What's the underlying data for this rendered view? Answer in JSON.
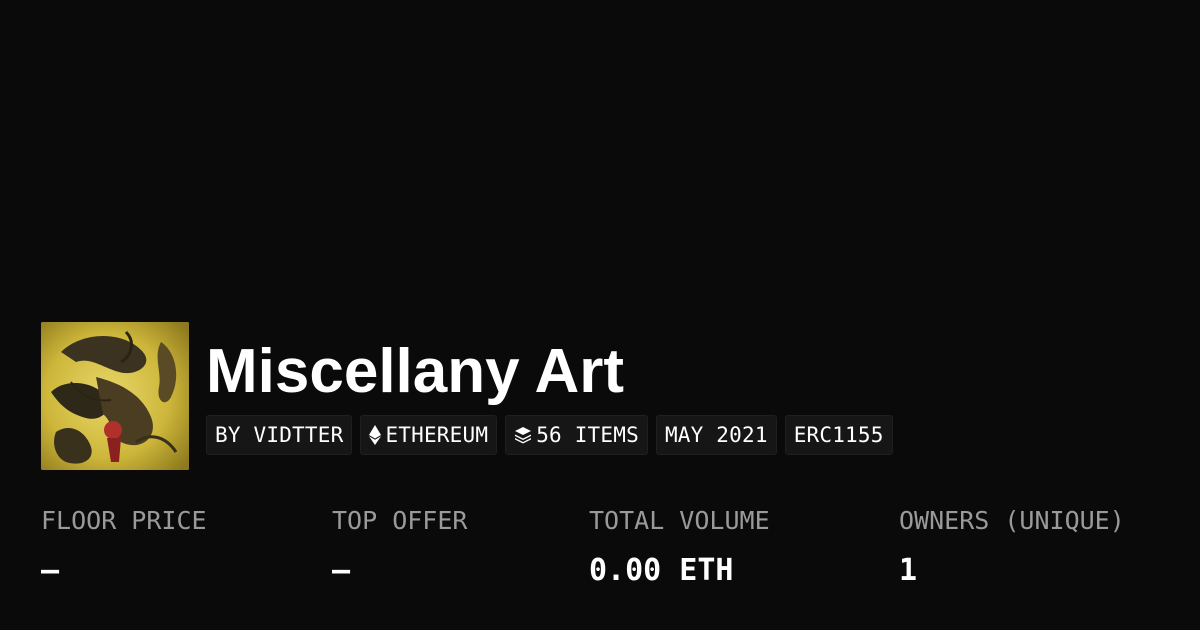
{
  "collection": {
    "title": "Miscellany Art",
    "avatar_icon": "collection-artwork-image"
  },
  "chips": {
    "creator": "BY VIDTTER",
    "chain": "ETHEREUM",
    "chain_icon": "ethereum-icon",
    "items": "56 ITEMS",
    "items_icon": "layers-icon",
    "date": "MAY 2021",
    "standard": "ERC1155"
  },
  "stats": {
    "floor_price": {
      "label": "FLOOR PRICE",
      "value": "—"
    },
    "top_offer": {
      "label": "TOP OFFER",
      "value": "—"
    },
    "total_volume": {
      "label": "TOTAL VOLUME",
      "value": "0.00 ETH"
    },
    "owners": {
      "label": "OWNERS (UNIQUE)",
      "value": "1"
    }
  },
  "colors": {
    "background": "#0a0a0a",
    "chip_background": "#161616",
    "label_gray": "#9a9a9a",
    "text": "#ffffff"
  }
}
